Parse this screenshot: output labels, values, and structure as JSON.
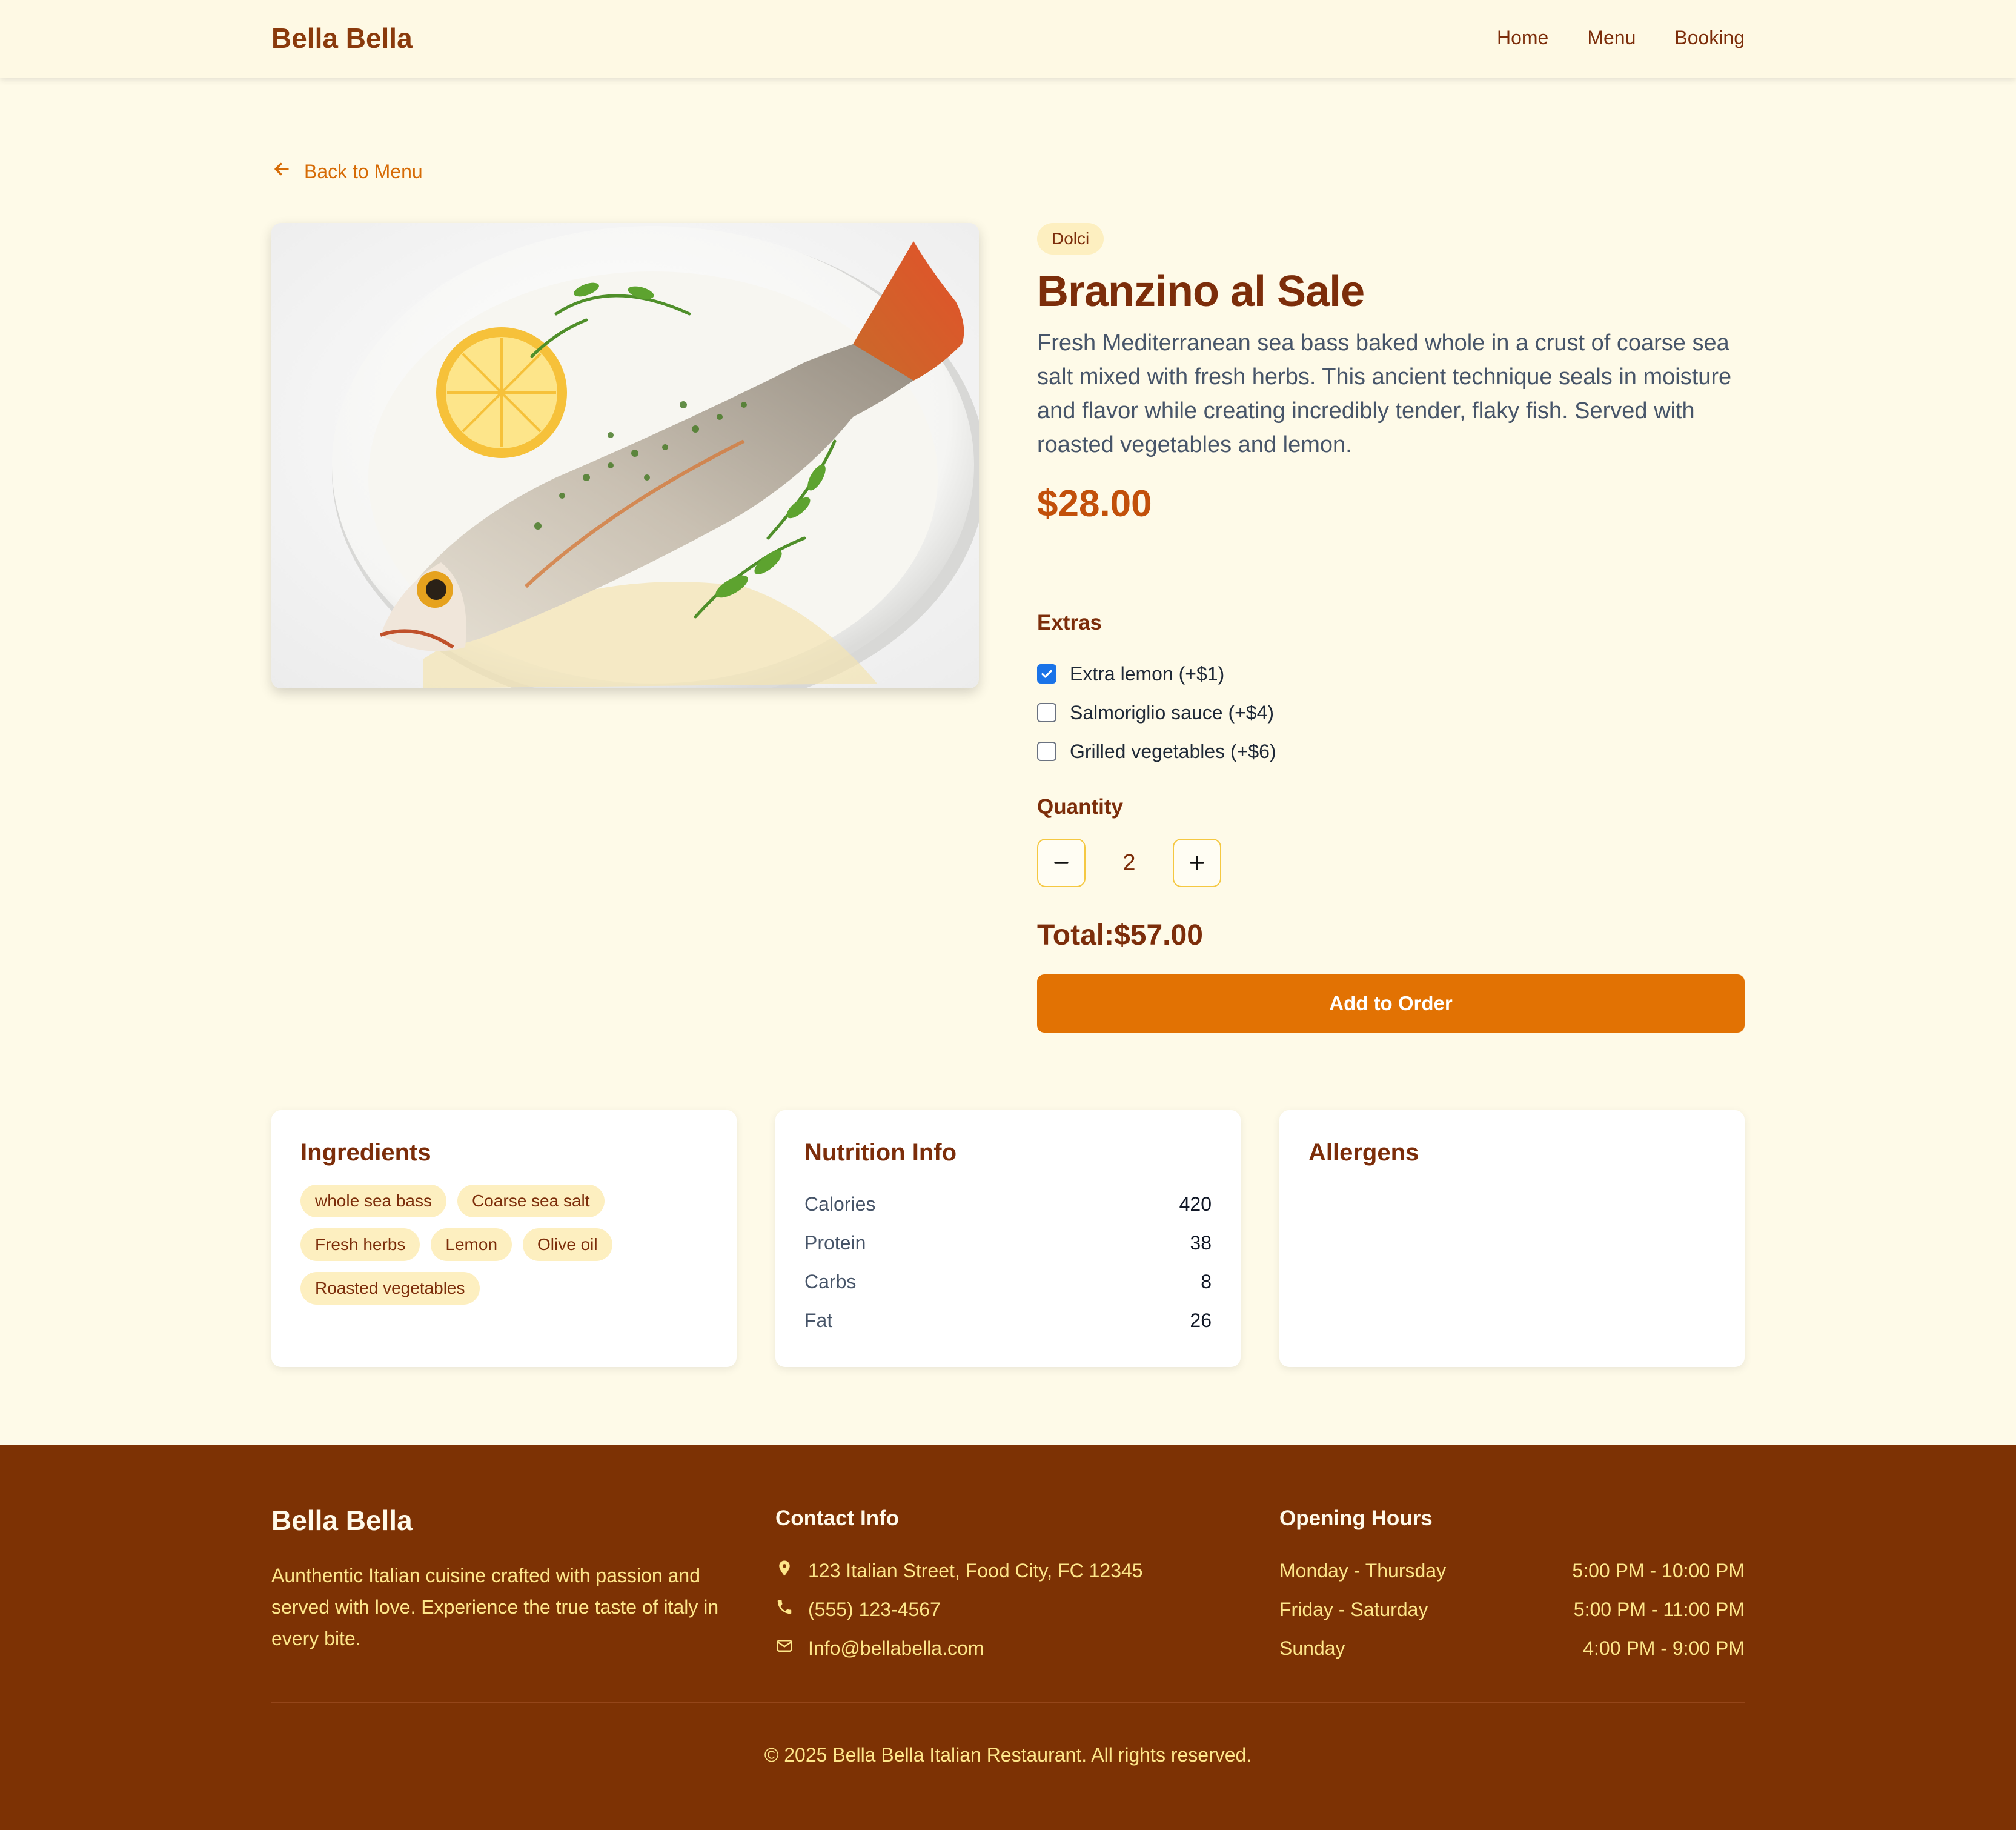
{
  "header": {
    "brand": "Bella Bella",
    "nav": [
      "Home",
      "Menu",
      "Booking"
    ]
  },
  "back_link": "Back to Menu",
  "dish": {
    "category": "Dolci",
    "title": "Branzino al Sale",
    "description": "Fresh Mediterranean sea bass baked whole in a crust of coarse sea salt mixed with fresh herbs. This ancient technique seals in moisture and flavor while creating incredibly tender, flaky fish. Served with roasted vegetables and lemon.",
    "price": "$28.00"
  },
  "extras": {
    "label": "Extras",
    "items": [
      {
        "label": "Extra lemon (+$1)",
        "checked": true
      },
      {
        "label": "Salmoriglio sauce (+$4)",
        "checked": false
      },
      {
        "label": "Grilled vegetables (+$6)",
        "checked": false
      }
    ]
  },
  "quantity": {
    "label": "Quantity",
    "value": "2"
  },
  "total": "Total:$57.00",
  "add_button": "Add to Order",
  "ingredients": {
    "title": "Ingredients",
    "items": [
      "whole sea bass",
      "Coarse sea salt",
      "Fresh herbs",
      "Lemon",
      "Olive oil",
      "Roasted vegetables"
    ]
  },
  "nutrition": {
    "title": "Nutrition Info",
    "rows": [
      {
        "name": "Calories",
        "value": "420"
      },
      {
        "name": "Protein",
        "value": "38"
      },
      {
        "name": "Carbs",
        "value": "8"
      },
      {
        "name": "Fat",
        "value": "26"
      }
    ]
  },
  "allergens": {
    "title": "Allergens"
  },
  "footer": {
    "brand": "Bella Bella",
    "about": "Aunthentic Italian cuisine crafted with passion and served with love. Experience the true taste of italy in every bite.",
    "contact_title": "Contact Info",
    "contact": [
      {
        "icon": "map-pin-icon",
        "text": "123 Italian Street, Food City, FC 12345"
      },
      {
        "icon": "phone-icon",
        "text": "(555) 123-4567"
      },
      {
        "icon": "mail-icon",
        "text": "Info@bellabella.com"
      }
    ],
    "hours_title": "Opening Hours",
    "hours": [
      {
        "day": "Monday - Thursday",
        "time": "5:00 PM - 10:00 PM"
      },
      {
        "day": "Friday - Saturday",
        "time": "5:00 PM - 11:00 PM"
      },
      {
        "day": "Sunday",
        "time": "4:00 PM - 9:00 PM"
      }
    ],
    "copyright": "© 2025 Bella Bella Italian Restaurant. All rights reserved."
  },
  "colors": {
    "background": "#fefae8",
    "brand": "#7c2d0a",
    "accent": "#e27203",
    "price": "#c2500a",
    "footer": "#7d3204",
    "checkbox_checked": "#1a73e8"
  }
}
